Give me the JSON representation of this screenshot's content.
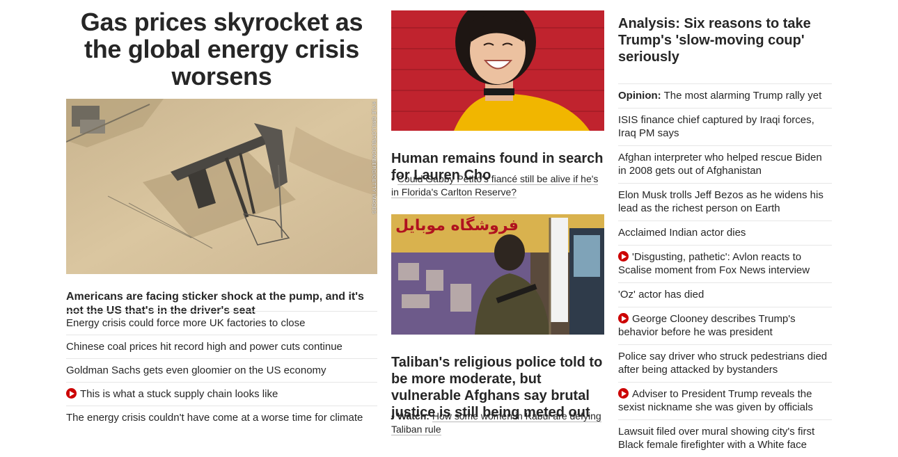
{
  "col1": {
    "headline": "Gas prices skyrocket as the global energy crisis worsens",
    "image_credit": "KYLE GRILLOT/BLOOMBERG/GETTY IMAGES",
    "lede": "Americans are facing sticker shock at the pump, and it's not the US that's in the driver's seat",
    "items": [
      {
        "text": "Energy crisis could force more UK factories to close",
        "video": false
      },
      {
        "text": "Chinese coal prices hit record high and power cuts continue",
        "video": false
      },
      {
        "text": "Goldman Sachs gets even gloomier on the US economy",
        "video": false
      },
      {
        "text": "This is what a stuck supply chain looks like",
        "video": true
      },
      {
        "text": "The energy crisis couldn't have come at a worse time for climate",
        "video": false
      }
    ]
  },
  "col2": {
    "story1": {
      "headline": "Human remains found in search for Lauren Cho",
      "sub": "Could Gabby Petito's fiancé still be alive if he's in Florida's Carlton Reserve?"
    },
    "story2": {
      "headline": "Taliban's religious police told to be more moderate, but vulnerable Afghans say brutal justice is still being meted out",
      "sub_prefix": "Watch:",
      "sub": "How some women in Kabul are defying Taliban rule",
      "shop_sign": "فروشگاه موبایل"
    }
  },
  "col3": {
    "headline": "Analysis: Six reasons to take Trump's 'slow-moving coup' seriously",
    "items": [
      {
        "prefix": "Opinion:",
        "text": "The most alarming Trump rally yet",
        "video": false
      },
      {
        "prefix": "",
        "text": "ISIS finance chief captured by Iraqi forces, Iraq PM says",
        "video": false
      },
      {
        "prefix": "",
        "text": "Afghan interpreter who helped rescue Biden in 2008 gets out of Afghanistan",
        "video": false
      },
      {
        "prefix": "",
        "text": "Elon Musk trolls Jeff Bezos as he widens his lead as the richest person on Earth",
        "video": false
      },
      {
        "prefix": "",
        "text": "Acclaimed Indian actor dies",
        "video": false
      },
      {
        "prefix": "",
        "text": "'Disgusting, pathetic': Avlon reacts to Scalise moment from Fox News interview",
        "video": true
      },
      {
        "prefix": "",
        "text": "'Oz' actor has died",
        "video": false
      },
      {
        "prefix": "",
        "text": "George Clooney describes Trump's behavior before he was president",
        "video": true
      },
      {
        "prefix": "",
        "text": "Police say driver who struck pedestrians died after being attacked by bystanders",
        "video": false
      },
      {
        "prefix": "",
        "text": "Adviser to President Trump reveals the sexist nickname she was given by officials",
        "video": true
      },
      {
        "prefix": "",
        "text": "Lawsuit filed over mural showing city's first Black female firefighter with a White face",
        "video": false
      }
    ]
  },
  "colors": {
    "text": "#262626",
    "video_red": "#cc0000",
    "divider": "#e6e6e6"
  }
}
